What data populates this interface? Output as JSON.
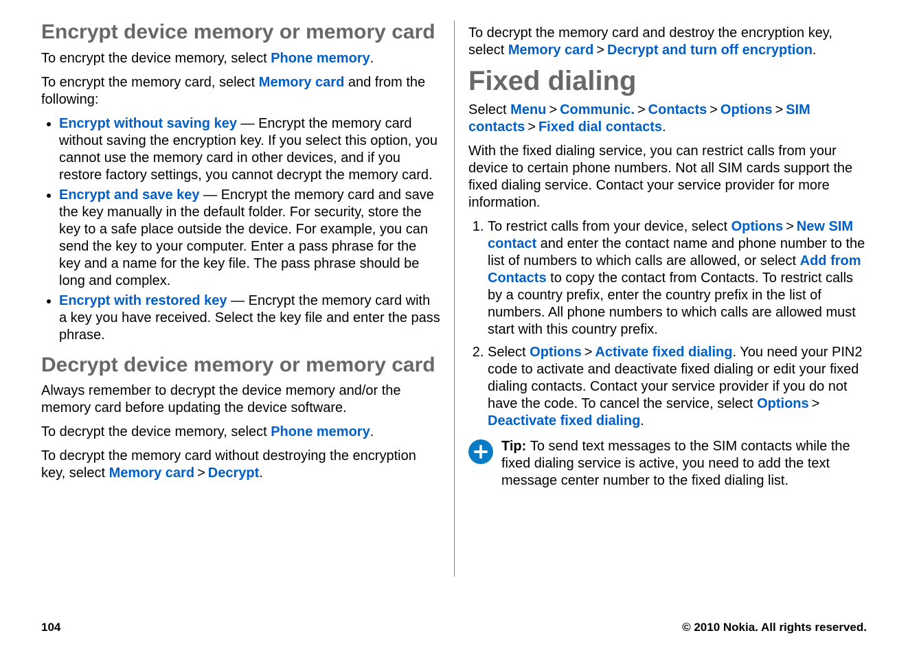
{
  "left": {
    "h2a": "Encrypt device memory or memory card",
    "p1a": "To encrypt the device memory, select ",
    "p1b": "Phone memory",
    "p1c": ".",
    "p2a": "To encrypt the memory card, select ",
    "p2b": "Memory card",
    "p2c": " and from the following:",
    "bul": [
      {
        "term": "Encrypt without saving key",
        "dash": "  — ",
        "rest": "Encrypt the memory card without saving the encryption key. If you select this option, you cannot use the memory card in other devices, and if you restore factory settings, you cannot decrypt the memory card."
      },
      {
        "term": "Encrypt and save key",
        "dash": "  — ",
        "rest": "Encrypt the memory card and save the key manually in the default folder. For security, store the key to a safe place outside the device. For example, you can send the key to your computer. Enter a pass phrase for the key and a name for the key file. The pass phrase should be long and complex."
      },
      {
        "term": "Encrypt with restored key",
        "dash": "  — ",
        "rest": "Encrypt the memory card with a key you have received. Select the key file and enter the pass phrase."
      }
    ],
    "h2b": "Decrypt device memory or memory card",
    "p3": "Always remember to decrypt the device memory and/or the memory card before updating the device software.",
    "p4a": "To decrypt the device memory, select ",
    "p4b": "Phone memory",
    "p4c": ".",
    "p5a": "To decrypt the memory card without destroying the encryption key, select ",
    "p5b": "Memory card",
    "p5c": " > ",
    "p5d": "Decrypt",
    "p5e": "."
  },
  "right": {
    "p0a": "To decrypt the memory card and destroy the encryption key, select ",
    "p0b": "Memory card",
    "p0c": " > ",
    "p0d": "Decrypt and turn off encryption",
    "p0e": ".",
    "h1": "Fixed dialing",
    "nav_pre": "Select ",
    "nav": [
      "Menu",
      "Communic.",
      "Contacts",
      "Options",
      "SIM contacts",
      "Fixed dial contacts"
    ],
    "nav_sep": " > ",
    "p1": "With the fixed dialing service, you can restrict calls from your device to certain phone numbers. Not all SIM cards support the fixed dialing service. Contact your service provider for more information.",
    "step1": {
      "a": "To restrict calls from your device, select ",
      "b": "Options",
      "c": " > ",
      "d": "New SIM contact",
      "e": " and enter the contact name and phone number to the list of numbers to which calls are allowed, or select ",
      "f": "Add from Contacts",
      "g": " to copy the contact from Contacts. To restrict calls by a country prefix, enter the country prefix in the list of numbers. All phone numbers to which calls are allowed must start with this country prefix."
    },
    "step2": {
      "a": "Select ",
      "b": "Options",
      "c": " > ",
      "d": "Activate fixed dialing",
      "e": ". You need your PIN2 code to activate and deactivate fixed dialing or edit your fixed dialing contacts. Contact your service provider if you do not have the code. To cancel the service, select ",
      "f": "Options",
      "g": " > ",
      "h": "Deactivate fixed dialing",
      "i": "."
    },
    "tip_label": "Tip: ",
    "tip_text": "To send text messages to the SIM contacts while the fixed dialing service is active, you need to add the text message center number to the fixed dialing list."
  },
  "footer": {
    "page": "104",
    "copy": "© 2010 Nokia. All rights reserved."
  }
}
